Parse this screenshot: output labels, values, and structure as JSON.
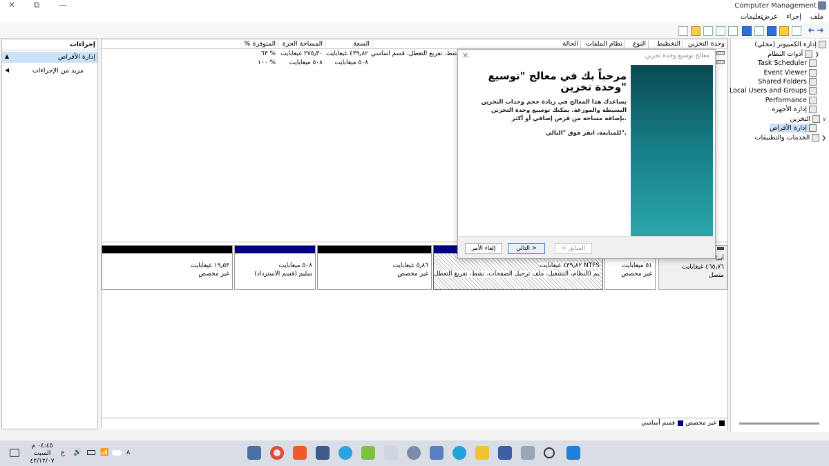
{
  "window": {
    "title": "Computer Management",
    "controls": {
      "close": "✕",
      "restore": "⧉",
      "minimize": "—"
    }
  },
  "menubar": {
    "items": [
      "ملف",
      "إجراء",
      "عرض",
      "تعليمات"
    ]
  },
  "tree": {
    "items": [
      {
        "label": "إدارة الكمبيوتر (محلي)",
        "icon": "computer-management-icon"
      },
      {
        "label": "أدوات النظام",
        "icon": "tools-icon"
      },
      {
        "label": "Task Scheduler",
        "icon": "clock-icon"
      },
      {
        "label": "Event Viewer",
        "icon": "event-viewer-icon"
      },
      {
        "label": "Shared Folders",
        "icon": "shared-folder-icon"
      },
      {
        "label": "Local Users and Groups",
        "icon": "users-icon"
      },
      {
        "label": "Performance",
        "icon": "performance-icon"
      },
      {
        "label": "إدارة الأجهزة",
        "icon": "device-manager-icon"
      },
      {
        "label": "التخزين",
        "icon": "storage-icon"
      },
      {
        "label": "إدارة الأقراص",
        "icon": "disk-management-icon"
      },
      {
        "label": "الخدمات والتطبيقات",
        "icon": "services-icon"
      }
    ]
  },
  "volume_list": {
    "columns": [
      "وحدة التخزين",
      "التخطيط",
      "النوع",
      "نظام الملفات",
      "الحالة",
      "السعة",
      "المساحة الحرة",
      "% المتوفرة"
    ],
    "rows": [
      {
        "status": "نشط، تفريغ التعطل، قسم أساسي)",
        "capacity": "٤٣٩٫٨٢ غيغابايت",
        "free": "٢٧٥٫٣٠ غيغابايت",
        "percent": "٦٣ %"
      },
      {
        "status": "",
        "capacity": "٥٠٨ ميغابايت",
        "free": "٥٠٨ ميغابايت",
        "percent": "١٠٠ %"
      }
    ]
  },
  "disk": {
    "label_line1": "أسا",
    "size": "٤٦٥٫٧٦ غيغابايت",
    "state": "متصل",
    "partitions": [
      {
        "size": "٥١ ميغابايت",
        "desc": "غير مخصص",
        "bar": "#000000"
      },
      {
        "size": "٤٣٩٫٨٢ غيغابايت NTFS",
        "desc": "سليم (النظام، التشغيل، ملف ترحيل الصفحات، نشط، تفريغ التعطل",
        "bar": "#000080"
      },
      {
        "size": "٥٫٨٦ غيغابايت",
        "desc": "غير مخصص",
        "bar": "#000000"
      },
      {
        "size": "٥٠٨ ميغابايت",
        "desc": "سليم (قسم الاسترداد)",
        "bar": "#000080"
      },
      {
        "size": "١٩٫٥٣ غيغابايت",
        "desc": "غير مخصص",
        "bar": "#000000"
      }
    ]
  },
  "legend": {
    "unallocated": "غير مخصص",
    "primary": "قسم أساسي"
  },
  "actions": {
    "header": "إجراءات",
    "selected": "إدارة الأقراص",
    "more": "مزيد من الإجراءات"
  },
  "wizard": {
    "title": "معالج توسيع وحدة تخزين",
    "heading": "مرحباً بك في معالج \"توسيع وحدة تخزين\"",
    "body": "يساعدك هذا المعالج في زيادة حجم وحدات التخزين البسيطة والموزعة. يمكنك توسيع وحدة التخزين بإضافة مساحة من قرص إضافي أو أكثر.",
    "next_hint": "للمتابعة، انقر فوق \"التالي\".",
    "buttons": {
      "back": "< السابق",
      "next": "التالي >",
      "cancel": "إلغاء الأمر"
    }
  },
  "taskbar": {
    "time": "٠٤:٤٥ م",
    "day": "السبت",
    "date": "٤٢/١٢/٠٧",
    "lang": "ع"
  },
  "colors": {
    "primary_partition": "#000080",
    "unallocated": "#000000",
    "accent": "#2d6fd6"
  }
}
